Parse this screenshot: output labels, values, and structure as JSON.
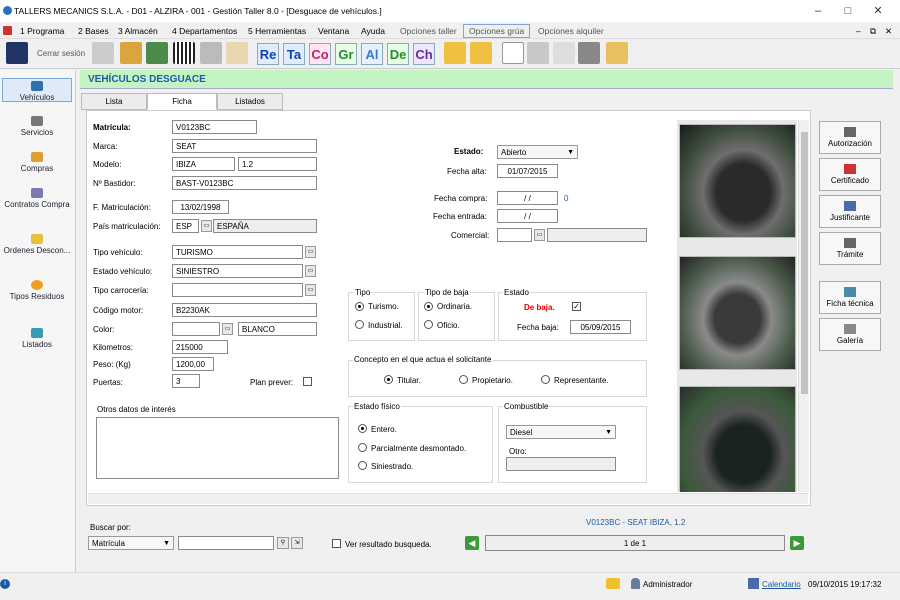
{
  "window": {
    "title": "TALLERS MECANICS S.L.A. - D01 - ALZIRA - 001 - Gestión Taller 8.0 - [Desguace de vehículos.]"
  },
  "menu": [
    "1 Programa",
    "2 Bases",
    "3 Almacén",
    "4 Departamentos",
    "5 Herramientas",
    "Ventana",
    "Ayuda",
    "Opciones taller",
    "Opciones grúa",
    "Opciones alquiler"
  ],
  "toolbar": {
    "cerrar": "Cerrar sesión",
    "letters": [
      "Re",
      "Ta",
      "Co",
      "Gr",
      "Al",
      "De",
      "Ch"
    ]
  },
  "sidebar": [
    "Vehículos",
    "Servicios",
    "Compras",
    "Contratos Compra",
    "Ordenes Descon...",
    "Tipos Residuos",
    "Listados"
  ],
  "header": "VEHÍCULOS DESGUACE",
  "tabs": [
    "Lista",
    "Ficha",
    "Listados"
  ],
  "form": {
    "matricula_l": "Matrícula:",
    "matricula": "V0123BC",
    "marca_l": "Marca:",
    "marca": "SEAT",
    "modelo_l": "Modelo:",
    "modelo": "IBIZA",
    "modelo2": "1.2",
    "bastidor_l": "Nº Bastidor:",
    "bastidor": "BAST-V0123BC",
    "fmat_l": "F. Matriculación:",
    "fmat": "13/02/1998",
    "pais_l": "País matriculación:",
    "pais_code": "ESP",
    "pais": "ESPAÑA",
    "tipo_l": "Tipo vehículo:",
    "tipo": "TURISMO",
    "estveh_l": "Estado vehículo:",
    "estveh": "SINIESTRO",
    "carroceria_l": "Tipo carrocería:",
    "motor_l": "Código motor:",
    "motor": "B2230AK",
    "color_l": "Color:",
    "color": "BLANCO",
    "km_l": "Kilometros:",
    "km": "215000",
    "peso_l": "Peso: (Kg)",
    "peso": "1200,00",
    "puertas_l": "Puertas:",
    "puertas": "3",
    "plan_l": "Plan prever:",
    "otros_l": "Otros datos de interés",
    "estado_l": "Estado:",
    "estado": "Abierto",
    "falta_l": "Fecha alta:",
    "falta": "01/07/2015",
    "fcompra_l": "Fecha compra:",
    "fcompra": "/ /",
    "fcompra_n": "0",
    "fentrada_l": "Fecha entrada:",
    "fentrada": "/ /",
    "comercial_l": "Comercial:",
    "tipo_g": "Tipo",
    "turismo": "Turismo.",
    "industrial": "Industrial.",
    "baja_g": "Tipo de baja",
    "ordinaria": "Ordinaria.",
    "oficio": "Oficio.",
    "estado_g": "Estado",
    "debaja": "De baja.",
    "fbaja_l": "Fecha baja:",
    "fbaja": "05/09/2015",
    "concepto_g": "Concepto en el que actua el solicitante",
    "titular": "Titular.",
    "propietario": "Propietario.",
    "representante": "Representante.",
    "fisico_g": "Estado físico",
    "entero": "Entero.",
    "parcial": "Parcialmente desmontado.",
    "siniestrado": "Siniestrado.",
    "comb_g": "Combustible",
    "comb": "Diesel",
    "otro_l": "Otro:"
  },
  "right_buttons": [
    "Autorización",
    "Certificado",
    "Justificante",
    "Trámite",
    "Ficha técnica",
    "Galería"
  ],
  "search": {
    "label": "Buscar por:",
    "field": "Matrícula",
    "ver": "Ver resultado busqueda.",
    "vehicle": "V0123BC - SEAT IBIZA, 1.2",
    "pager": "1 de 1"
  },
  "status": {
    "user": "Administrador",
    "calendar": "Calendario",
    "datetime": "09/10/2015 19:17:32"
  },
  "colors": {
    "header_bg": "#c4f4c4",
    "accent": "#1d5aa5",
    "debaja": "#e00000"
  }
}
